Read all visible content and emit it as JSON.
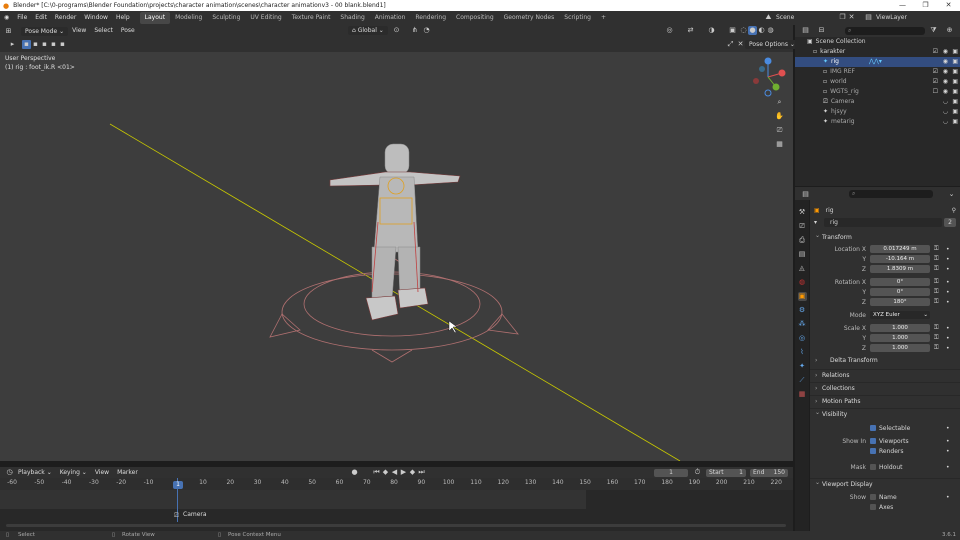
{
  "window": {
    "title": "Blender* [C:\\0-programs\\Blender Foundation\\projects\\character animation\\scenes\\character animationv3 - 00 blank.blend1]"
  },
  "menus": [
    "File",
    "Edit",
    "Render",
    "Window",
    "Help"
  ],
  "workspaces": [
    "Layout",
    "Modeling",
    "Sculpting",
    "UV Editing",
    "Texture Paint",
    "Shading",
    "Animation",
    "Rendering",
    "Compositing",
    "Geometry Nodes",
    "Scripting"
  ],
  "active_workspace": "Layout",
  "scene": {
    "name": "Scene",
    "view_layer": "ViewLayer"
  },
  "viewport": {
    "mode": "Pose Mode",
    "menus": [
      "View",
      "Select",
      "Pose"
    ],
    "transform_orientation": "Global",
    "pose_options": "Pose Options",
    "view_label": "User Perspective",
    "active_info": "(1) rig : foot_ik.R <01>"
  },
  "outliner": {
    "collection": "Scene Collection",
    "items": [
      {
        "name": "karakter",
        "level": 0
      },
      {
        "name": "rig",
        "level": 1,
        "selected": true
      },
      {
        "name": "IMG REF",
        "level": 1
      },
      {
        "name": "world",
        "level": 1
      },
      {
        "name": "WGTS_rig",
        "level": 1
      },
      {
        "name": "Camera",
        "level": 1
      },
      {
        "name": "hjsyy",
        "level": 1
      },
      {
        "name": "metarig",
        "level": 1
      }
    ]
  },
  "properties": {
    "object_name": "rig",
    "data_name": "rig",
    "users": "2",
    "transform_label": "Transform",
    "location": {
      "label": "Location X",
      "x": "0.017249 m",
      "y": "-10.164 m",
      "z": "1.8309 m"
    },
    "rotation": {
      "label": "Rotation X",
      "x": "0°",
      "y": "0°",
      "z": "180°"
    },
    "mode": {
      "label": "Mode",
      "value": "XYZ Euler"
    },
    "scale": {
      "label": "Scale X",
      "x": "1.000",
      "y": "1.000",
      "z": "1.000"
    },
    "axes": {
      "y": "Y",
      "z": "Z"
    },
    "panels": [
      "Delta Transform",
      "Relations",
      "Collections",
      "Motion Paths"
    ],
    "visibility": {
      "label": "Visibility",
      "selectable": "Selectable",
      "show_in": "Show In",
      "viewports": "Viewports",
      "renders": "Renders",
      "mask": "Mask",
      "holdout": "Holdout"
    },
    "viewport_display": {
      "label": "Viewport Display",
      "show": "Show",
      "name": "Name",
      "axes": "Axes"
    }
  },
  "timeline": {
    "menus": [
      "Playback",
      "Keying",
      "View",
      "Marker"
    ],
    "current_frame": "1",
    "start_label": "Start",
    "start": "1",
    "end_label": "End",
    "end": "150",
    "ticks": [
      "-60",
      "-50",
      "-40",
      "-30",
      "-20",
      "-10",
      "1",
      "10",
      "20",
      "30",
      "40",
      "50",
      "60",
      "70",
      "80",
      "90",
      "100",
      "110",
      "120",
      "130",
      "140",
      "150",
      "160",
      "170",
      "180",
      "190",
      "200",
      "210",
      "220"
    ],
    "marker": "Camera"
  },
  "statusbar": {
    "items": [
      "Select",
      "Rotate View",
      "Pose Context Menu"
    ],
    "version": "3.6.1"
  },
  "colors": {
    "accent": "#4772b3",
    "grid_x": "#d0d000",
    "header": "#303030",
    "viewport": "#3d3d3d"
  }
}
